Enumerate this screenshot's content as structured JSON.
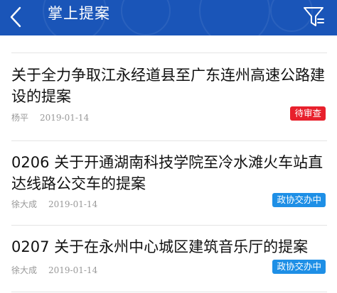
{
  "header": {
    "title": "掌上提案",
    "back_icon": "chevron-left-icon",
    "filter_icon": "filter-icon",
    "background_color": "#1a55b8"
  },
  "proposals": [
    {
      "title": "关于全力争取江永经道县至广东连州高速公路建设的提案",
      "author": "杨平",
      "date": "2019-01-14",
      "status": "待审查",
      "status_color": "#e8202c"
    },
    {
      "title": "0206 关于开通湖南科技学院至冷水滩火车站直达线路公交车的提案",
      "author": "徐大成",
      "date": "2019-01-14",
      "status": "政协交办中",
      "status_color": "#1e8fe6"
    },
    {
      "title": "0207 关于在永州中心城区建筑音乐厅的提案",
      "author": "徐大成",
      "date": "2019-01-14",
      "status": "政协交办中",
      "status_color": "#1e8fe6"
    }
  ]
}
